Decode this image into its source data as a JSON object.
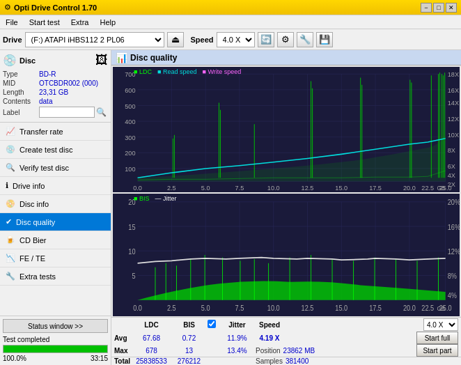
{
  "titlebar": {
    "title": "Opti Drive Control 1.70",
    "icon": "⚙",
    "controls": [
      "−",
      "□",
      "✕"
    ]
  },
  "menubar": {
    "items": [
      "File",
      "Start test",
      "Extra",
      "Help"
    ]
  },
  "toolbar": {
    "label": "Drive",
    "drive_value": "(F:) ATAPI iHBS112  2 PL06",
    "speed_label": "Speed",
    "speed_value": "4.0 X",
    "icons": [
      "eject",
      "settings1",
      "settings2",
      "save"
    ]
  },
  "disc": {
    "header": "Disc",
    "type_label": "Type",
    "type_val": "BD-R",
    "mid_label": "MID",
    "mid_val": "OTCBDR002 (000)",
    "length_label": "Length",
    "length_val": "23,31 GB",
    "contents_label": "Contents",
    "contents_val": "data",
    "label_label": "Label",
    "label_val": ""
  },
  "nav_items": [
    {
      "id": "transfer-rate",
      "label": "Transfer rate",
      "icon": "📈"
    },
    {
      "id": "create-test-disc",
      "label": "Create test disc",
      "icon": "💿"
    },
    {
      "id": "verify-test-disc",
      "label": "Verify test disc",
      "icon": "🔍"
    },
    {
      "id": "drive-info",
      "label": "Drive info",
      "icon": "ℹ"
    },
    {
      "id": "disc-info",
      "label": "Disc info",
      "icon": "📀"
    },
    {
      "id": "disc-quality",
      "label": "Disc quality",
      "icon": "✔",
      "active": true
    },
    {
      "id": "cd-bier",
      "label": "CD Bier",
      "icon": "🍺"
    },
    {
      "id": "fe-te",
      "label": "FE / TE",
      "icon": "📉"
    },
    {
      "id": "extra-tests",
      "label": "Extra tests",
      "icon": "🔧"
    }
  ],
  "status": {
    "btn_label": "Status window >>",
    "text": "Test completed",
    "progress": 100,
    "time": "33:15"
  },
  "chart_header": {
    "title": "Disc quality"
  },
  "chart1": {
    "legend": {
      "ldc": "LDC",
      "read": "Read speed",
      "write": "Write speed"
    },
    "y_labels": [
      "700",
      "600",
      "500",
      "400",
      "300",
      "200",
      "100"
    ],
    "y_right": [
      "18X",
      "16X",
      "14X",
      "12X",
      "10X",
      "8X",
      "6X",
      "4X",
      "2X"
    ],
    "x_labels": [
      "0.0",
      "2.5",
      "5.0",
      "7.5",
      "10.0",
      "12.5",
      "15.0",
      "17.5",
      "20.0",
      "22.5",
      "25.0"
    ]
  },
  "chart2": {
    "legend": {
      "bis": "BIS",
      "jitter": "Jitter"
    },
    "y_labels": [
      "20",
      "15",
      "10",
      "5"
    ],
    "y_right": [
      "20%",
      "16%",
      "12%",
      "8%",
      "4%"
    ],
    "x_labels": [
      "0.0",
      "2.5",
      "5.0",
      "7.5",
      "10.0",
      "12.5",
      "15.0",
      "17.5",
      "20.0",
      "22.5",
      "25.0"
    ]
  },
  "stats": {
    "columns": [
      "",
      "LDC",
      "BIS",
      "",
      "Jitter",
      "Speed",
      ""
    ],
    "avg_label": "Avg",
    "max_label": "Max",
    "total_label": "Total",
    "ldc_avg": "67.68",
    "ldc_max": "678",
    "ldc_total": "25838533",
    "bis_avg": "0.72",
    "bis_max": "13",
    "bis_total": "276212",
    "jitter_avg": "11.9%",
    "jitter_max": "13.4%",
    "speed_label": "Speed",
    "speed_val": "4.19 X",
    "position_label": "Position",
    "position_val": "23862 MB",
    "samples_label": "Samples",
    "samples_val": "381400"
  },
  "actions": {
    "jitter_checked": true,
    "jitter_label": "Jitter",
    "speed_label": "Speed",
    "speed_val": "4.0 X",
    "start_full_label": "Start full",
    "start_part_label": "Start part"
  }
}
